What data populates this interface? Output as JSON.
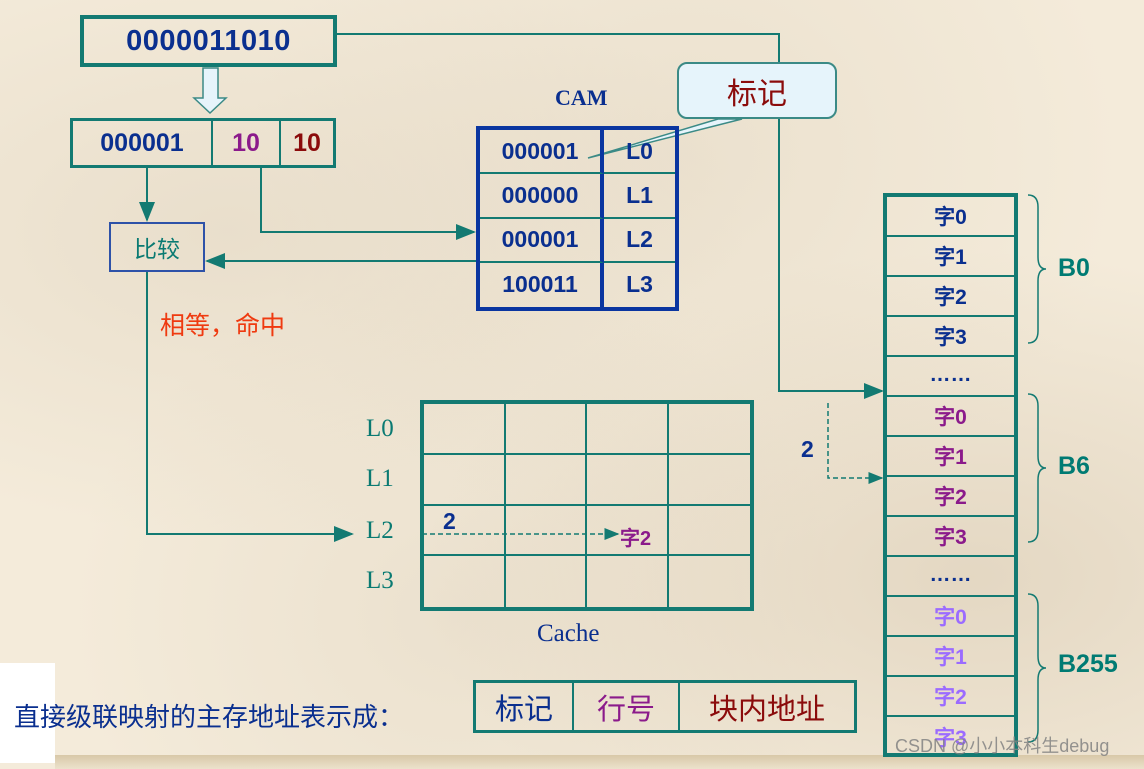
{
  "address": {
    "full": "0000011010",
    "tag": "000001",
    "line": "10",
    "offset": "10"
  },
  "cam": {
    "title": "CAM",
    "rows": [
      {
        "tag": "000001",
        "line": "L0"
      },
      {
        "tag": "000000",
        "line": "L1"
      },
      {
        "tag": "000001",
        "line": "L2"
      },
      {
        "tag": "100011",
        "line": "L3"
      }
    ]
  },
  "callout": {
    "text": "标记"
  },
  "compare": {
    "label": "比较",
    "result": "相等，命中"
  },
  "cache": {
    "title": "Cache",
    "lines": [
      "L0",
      "L1",
      "L2",
      "L3"
    ],
    "offset_label": "2",
    "word_label": "字2"
  },
  "memory": {
    "blocks": [
      {
        "name": "B0",
        "words": [
          "字0",
          "字1",
          "字2",
          "字3"
        ]
      },
      {
        "name": "B6",
        "words": [
          "字0",
          "字1",
          "字2",
          "字3"
        ]
      },
      {
        "name": "B255",
        "words": [
          "字0",
          "字1",
          "字2",
          "字3"
        ]
      }
    ],
    "ellipsis": "……",
    "offset_label": "2"
  },
  "format": {
    "caption": "直接级联映射的主存地址表示成：",
    "fields": [
      "标记",
      "行号",
      "块内地址"
    ]
  },
  "colors": {
    "teal": "#137a72",
    "navy": "#0a2f8f",
    "purple": "#8b1a8b",
    "maroon": "#8b0b0b",
    "light_purple": "#9b6bff",
    "hit_red": "#ef3a10"
  },
  "watermark": "CSDN @小小本科生debug"
}
